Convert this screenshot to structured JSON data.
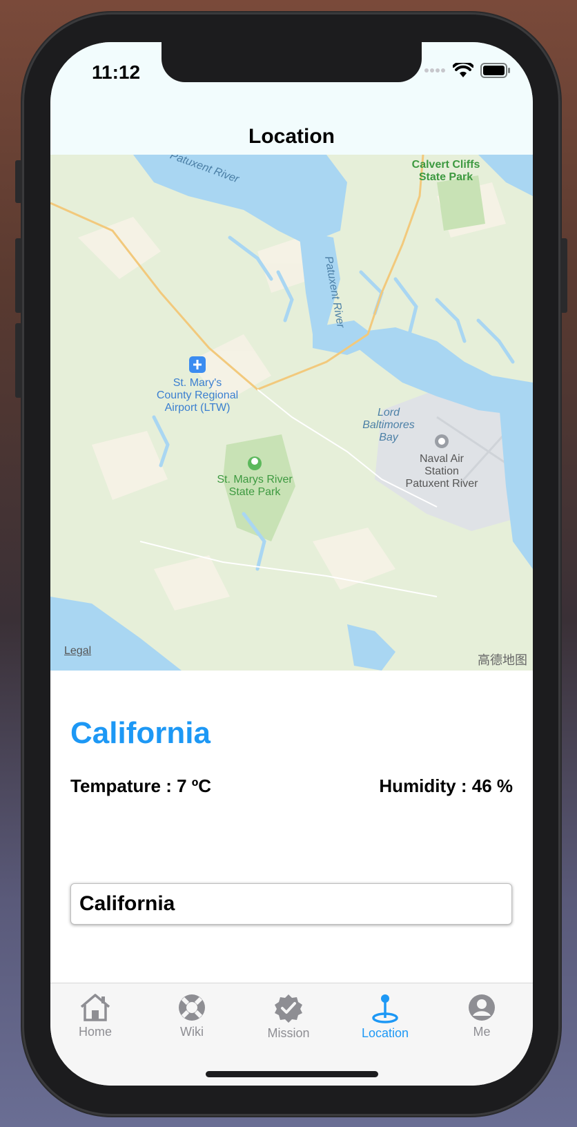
{
  "status": {
    "time": "11:12"
  },
  "nav": {
    "title": "Location"
  },
  "map": {
    "labels": {
      "river_top": "Patuxent River",
      "calvert_line1": "Calvert Cliffs",
      "calvert_line2": "State Park",
      "patuxent_vertical": "Patuxent River",
      "airport_line1": "St. Mary's",
      "airport_line2": "County Regional",
      "airport_line3": "Airport (LTW)",
      "lord_line1": "Lord",
      "lord_line2": "Baltimores",
      "lord_line3": "Bay",
      "naval_line1": "Naval Air",
      "naval_line2": "Station",
      "naval_line3": "Patuxent River",
      "park_line1": "St. Marys River",
      "park_line2": "State Park"
    },
    "legal": "Legal",
    "attribution": "高德地图"
  },
  "weather": {
    "city": "California",
    "temperature": "Tempature : 7 ºC",
    "humidity": "Humidity : 46 %"
  },
  "search": {
    "value": "California"
  },
  "tabs": [
    {
      "label": "Home",
      "icon": "house-icon"
    },
    {
      "label": "Wiki",
      "icon": "lifebuoy-icon"
    },
    {
      "label": "Mission",
      "icon": "checkmark-seal-icon"
    },
    {
      "label": "Location",
      "icon": "map-pin-icon",
      "active": true
    },
    {
      "label": "Me",
      "icon": "person-circle-icon"
    }
  ],
  "colors": {
    "accent": "#1d98f5",
    "water": "#a9d6f2",
    "land": "#e6efd9",
    "park": "#c8e2b5"
  }
}
